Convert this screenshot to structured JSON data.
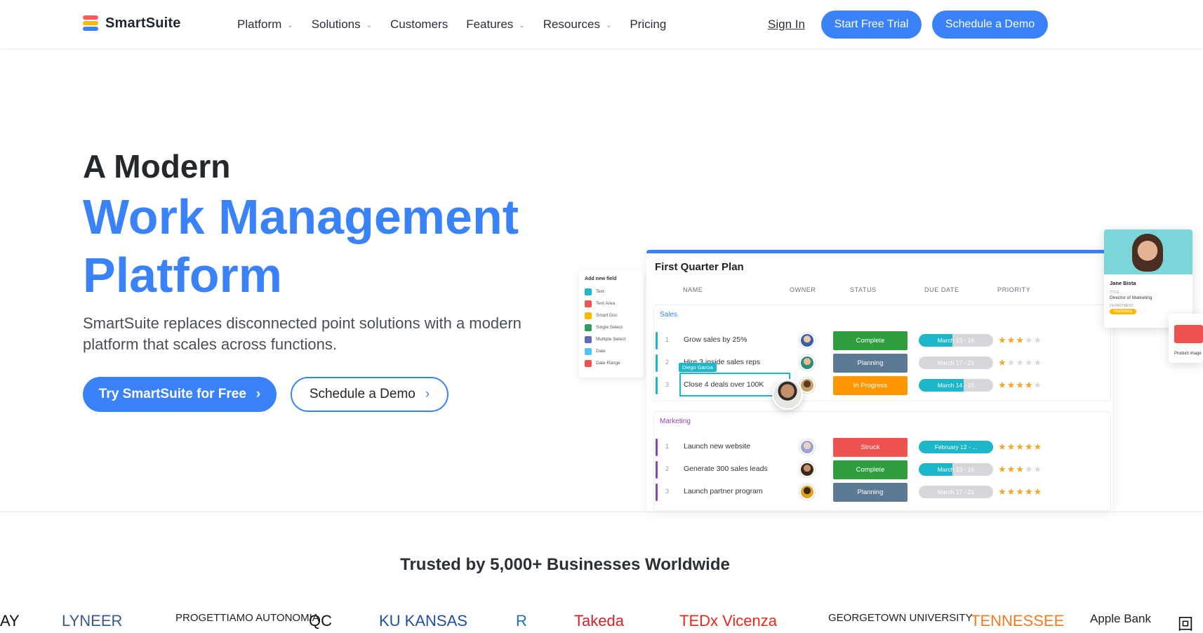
{
  "nav": {
    "brand": "SmartSuite",
    "menu": [
      {
        "label": "Platform",
        "has_dropdown": true
      },
      {
        "label": "Solutions",
        "has_dropdown": true
      },
      {
        "label": "Customers",
        "has_dropdown": false
      },
      {
        "label": "Features",
        "has_dropdown": true
      },
      {
        "label": "Resources",
        "has_dropdown": true
      },
      {
        "label": "Pricing",
        "has_dropdown": false
      }
    ],
    "sign_in": "Sign In",
    "start_trial": "Start Free Trial",
    "schedule_demo": "Schedule a Demo"
  },
  "hero": {
    "pre_title": "A Modern",
    "title": "Work Management Platform",
    "subtitle": "SmartSuite replaces disconnected point solutions with a modern platform that scales across functions.",
    "primary_cta": "Try SmartSuite for Free",
    "secondary_cta": "Schedule a Demo",
    "accent_color": "#3a82f7"
  },
  "mockup": {
    "field_panel": {
      "title": "Add new field",
      "fields": [
        {
          "label": "Text",
          "color": "#1eb6c9"
        },
        {
          "label": "Text Area",
          "color": "#ef5350"
        },
        {
          "label": "Smart Doc",
          "color": "#ffb800"
        },
        {
          "label": "Single Select",
          "color": "#2e9e5b"
        },
        {
          "label": "Multiple Select",
          "color": "#5c6bc0"
        },
        {
          "label": "Date",
          "color": "#4fc3f7"
        },
        {
          "label": "Date Range",
          "color": "#ef5350"
        }
      ]
    },
    "board_title": "First Quarter Plan",
    "columns": [
      "NAME",
      "OWNER",
      "STATUS",
      "DUE DATE",
      "PRIORITY"
    ],
    "groups": [
      {
        "name": "Sales",
        "color": "#3a82f7",
        "bar_color": "#1eb6c9",
        "rows": [
          {
            "num": "1",
            "name": "Grow sales by 25%",
            "status": "Complete",
            "status_color": "#2e9e3f",
            "due": "March 13 - 16",
            "due_progress": 0.45,
            "stars": 3
          },
          {
            "num": "2",
            "name": "Hire 3 inside sales reps",
            "status": "Planning",
            "status_color": "#5c7a93",
            "due": "March 17 - 21",
            "due_progress": 0.0,
            "stars": 1
          },
          {
            "num": "3",
            "name": "Close 4 deals over 100K",
            "status": "In Progress",
            "status_color": "#ff9800",
            "due": "March 14 - 15",
            "due_progress": 0.6,
            "stars": 4
          }
        ]
      },
      {
        "name": "Marketing",
        "color": "#8e44ad",
        "bar_color": "#8e44ad",
        "rows": [
          {
            "num": "1",
            "name": "Launch new website",
            "status": "Struck",
            "status_color": "#ef5350",
            "due": "February 12 - ...",
            "due_progress": 1.0,
            "stars": 5
          },
          {
            "num": "2",
            "name": "Generate 300 sales leads",
            "status": "Complete",
            "status_color": "#2e9e3f",
            "due": "March 13 - 16",
            "due_progress": 0.45,
            "stars": 3
          },
          {
            "num": "3",
            "name": "Launch partner program",
            "status": "Planning",
            "status_color": "#5c7a93",
            "due": "March 17 - 21",
            "due_progress": 0.0,
            "stars": 5
          }
        ]
      }
    ],
    "edit_tag": "Diego Garcia",
    "profile": {
      "name": "Jane Bista",
      "title_label": "TITLE",
      "title": "Director of Marketing",
      "dept_label": "DEPARTMENT",
      "department": "Marketing"
    },
    "side_card_label": "Product image"
  },
  "trusted": {
    "heading": "Trusted by 5,000+ Businesses Worldwide",
    "logos": [
      "AY",
      "LYNEER",
      "PROGETTIAMO AUTONOMIA",
      "QC",
      "KU KANSAS",
      "R",
      "Takeda",
      "TEDx Vicenza",
      "GEORGETOWN UNIVERSITY",
      "TENNESSEE",
      "Apple Bank",
      "回"
    ]
  }
}
